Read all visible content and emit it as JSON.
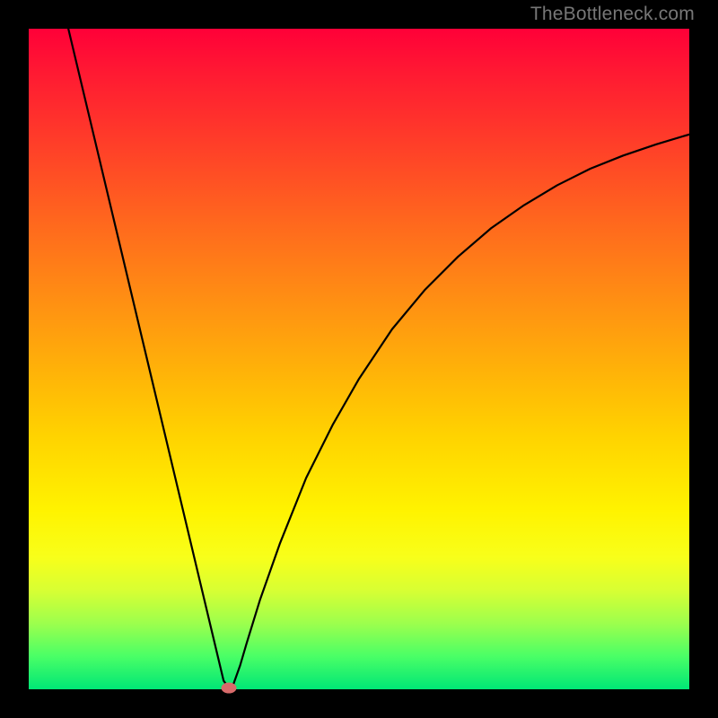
{
  "watermark": "TheBottleneck.com",
  "chart_data": {
    "type": "line",
    "title": "",
    "xlabel": "",
    "ylabel": "",
    "xlim": [
      0,
      100
    ],
    "ylim": [
      0,
      100
    ],
    "series": [
      {
        "name": "curve",
        "x": [
          6,
          8,
          10,
          12,
          14,
          16,
          18,
          20,
          22,
          24,
          26,
          28,
          29.5,
          30.3,
          31,
          32,
          33,
          35,
          38,
          42,
          46,
          50,
          55,
          60,
          65,
          70,
          75,
          80,
          85,
          90,
          95,
          100
        ],
        "y": [
          100,
          91.6,
          83.2,
          74.8,
          66.4,
          58,
          49.6,
          41.2,
          32.8,
          24.4,
          16,
          7.6,
          1.3,
          0.2,
          0.8,
          3.6,
          7,
          13.5,
          22,
          32,
          40,
          47,
          54.5,
          60.5,
          65.5,
          69.8,
          73.3,
          76.3,
          78.8,
          80.8,
          82.5,
          84
        ]
      }
    ],
    "marker": {
      "x": 30.3,
      "y": 0.2
    },
    "background_gradient": {
      "direction": "top-to-bottom",
      "stops": [
        {
          "pos": 0.0,
          "color": "#ff0038"
        },
        {
          "pos": 0.5,
          "color": "#ffb308"
        },
        {
          "pos": 0.75,
          "color": "#fff300"
        },
        {
          "pos": 1.0,
          "color": "#00e676"
        }
      ]
    }
  }
}
